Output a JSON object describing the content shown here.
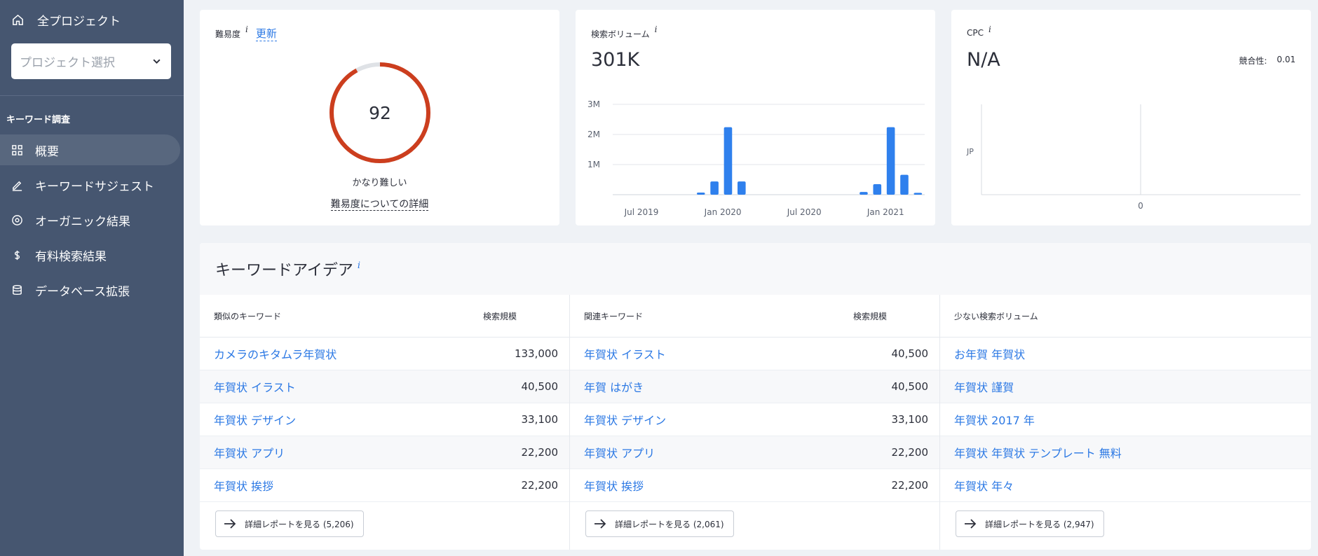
{
  "sidebar": {
    "all_projects": "全プロジェクト",
    "project_select_placeholder": "プロジェクト選択",
    "section_title": "キーワード調査",
    "items": [
      {
        "label": "概要",
        "icon": "grid-icon",
        "active": true
      },
      {
        "label": "キーワードサジェスト",
        "icon": "pencil-icon",
        "active": false
      },
      {
        "label": "オーガニック結果",
        "icon": "target-icon",
        "active": false
      },
      {
        "label": "有料検索結果",
        "icon": "dollar-icon",
        "active": false
      },
      {
        "label": "データベース拡張",
        "icon": "database-icon",
        "active": false
      }
    ]
  },
  "difficulty": {
    "label": "難易度",
    "info": "i",
    "update_link": "更新",
    "score": "92",
    "score_value": 92,
    "caption": "かなり難しい",
    "detail_link": "難易度についての詳細",
    "ring_color": "#cc3e1e",
    "track_color": "#dfe2e6"
  },
  "volume": {
    "label": "検索ボリューム",
    "info": "i",
    "value": "301K",
    "chart_data": {
      "type": "bar",
      "x_tick_labels": [
        "Jul 2019",
        "Jan 2020",
        "Jul 2020",
        "Jan 2021"
      ],
      "y_tick_labels": [
        "3M",
        "2M",
        "1M"
      ],
      "ylim": [
        0,
        3000000
      ],
      "values": [
        0,
        0,
        0,
        0,
        0,
        0,
        70000,
        440000,
        2240000,
        440000,
        0,
        0,
        0,
        0,
        0,
        0,
        0,
        0,
        90000,
        350000,
        2240000,
        660000,
        60000
      ],
      "bar_color": "#2f80ed",
      "grid": true
    }
  },
  "cpc": {
    "label": "CPC",
    "info": "i",
    "value": "N/A",
    "competition_label": "競合性:",
    "competition_value": "0.01",
    "chart_data": {
      "type": "bar",
      "categories": [
        "JP"
      ],
      "values": [
        0
      ],
      "x_tick_labels": [
        "0"
      ]
    }
  },
  "ideas": {
    "title": "キーワードアイデア",
    "info": "i",
    "columns": [
      {
        "header": "類似のキーワード",
        "vol_header": "検索規模",
        "rows": [
          {
            "kw": "カメラのキタムラ年賀状",
            "vol": "133,000"
          },
          {
            "kw": "年賀状 イラスト",
            "vol": "40,500"
          },
          {
            "kw": "年賀状 デザイン",
            "vol": "33,100"
          },
          {
            "kw": "年賀状 アプリ",
            "vol": "22,200"
          },
          {
            "kw": "年賀状 挨拶",
            "vol": "22,200"
          }
        ],
        "button": "詳細レポートを見る (5,206)"
      },
      {
        "header": "関連キーワード",
        "vol_header": "検索規模",
        "rows": [
          {
            "kw": "年賀状 イラスト",
            "vol": "40,500"
          },
          {
            "kw": "年賀 はがき",
            "vol": "40,500"
          },
          {
            "kw": "年賀状 デザイン",
            "vol": "33,100"
          },
          {
            "kw": "年賀状 アプリ",
            "vol": "22,200"
          },
          {
            "kw": "年賀状 挨拶",
            "vol": "22,200"
          }
        ],
        "button": "詳細レポートを見る (2,061)"
      },
      {
        "header": "少ない検索ボリューム",
        "vol_header": "",
        "rows": [
          {
            "kw": "お年賀 年賀状",
            "vol": ""
          },
          {
            "kw": "年賀状 謹賀",
            "vol": ""
          },
          {
            "kw": "年賀状 2017 年",
            "vol": ""
          },
          {
            "kw": "年賀状 年賀状 テンプレート 無料",
            "vol": ""
          },
          {
            "kw": "年賀状 年々",
            "vol": ""
          }
        ],
        "button": "詳細レポートを見る (2,947)"
      }
    ]
  }
}
